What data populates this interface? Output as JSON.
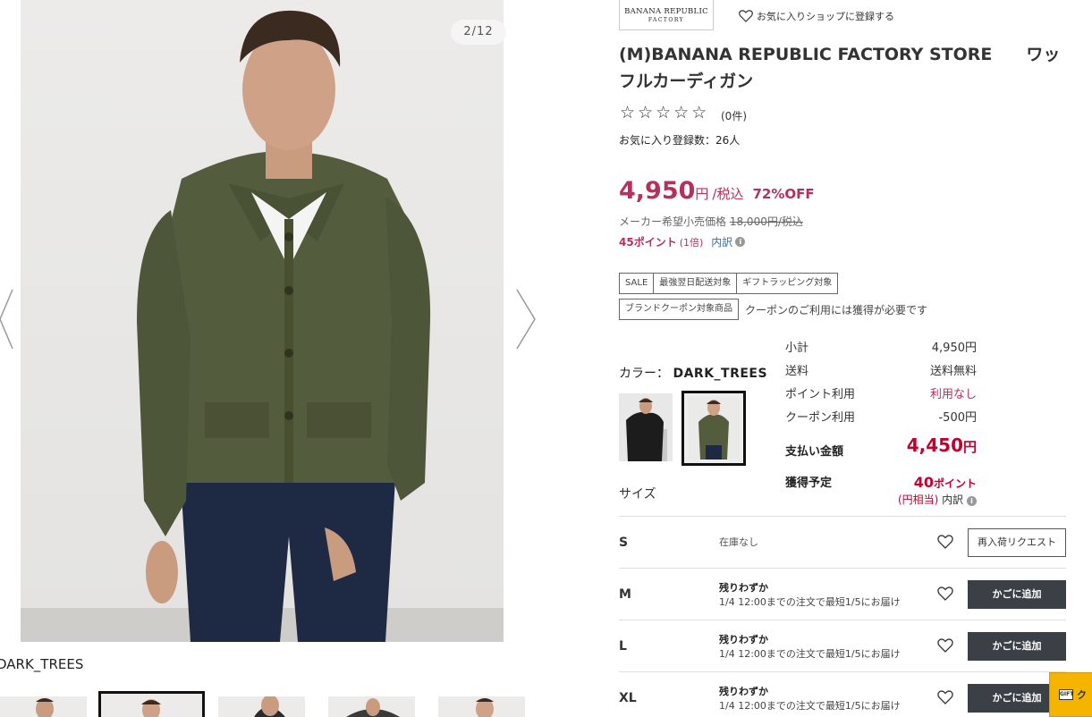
{
  "gallery": {
    "counter": "2/12",
    "color_name": "DARK_TREES"
  },
  "shop": {
    "logo_line1": "BANANA REPUBLIC",
    "logo_line2": "FACTORY",
    "fav_shop_label": "お気に入りショップに登録する"
  },
  "product": {
    "title": "(M)BANANA REPUBLIC FACTORY STORE　　ワッフルカーディガン",
    "stars": "☆☆☆☆☆",
    "review_count": "(0件)",
    "fav_count": "お気に入り登録数：26人"
  },
  "price": {
    "amount": "4,950",
    "yen": "円",
    "tax": "/税込",
    "discount": "72%OFF",
    "msrp_label": "メーカー希望小売価格",
    "msrp_value": "18,000円/税込",
    "points": "45ポイント",
    "points_mult": "(1倍)",
    "breakdown_link": "内訳"
  },
  "tags": [
    "SALE",
    "最強翌日配送対象",
    "ギフトラッピング対象"
  ],
  "coupon": {
    "tag": "ブランドクーポン対象商品",
    "note": "クーポンのご利用には獲得が必要です"
  },
  "color": {
    "label": "カラー：",
    "value": "DARK_TREES",
    "swatches": [
      "black",
      "dark-trees"
    ]
  },
  "size_label": "サイズ",
  "summary": {
    "subtotal_label": "小計",
    "subtotal_value": "4,950円",
    "shipping_label": "送料",
    "shipping_value": "送料無料",
    "points_use_label": "ポイント利用",
    "points_use_value": "利用なし",
    "coupon_use_label": "クーポン利用",
    "coupon_use_value": "-500円",
    "pay_label": "支払い金額",
    "pay_amount": "4,450",
    "pay_yen": "円",
    "earn_label": "獲得予定",
    "earn_amount": "40",
    "earn_unit": "ポイント",
    "earn_equiv": "(円相当)",
    "earn_breakdown": "内訳"
  },
  "sizes": [
    {
      "size": "S",
      "stock": "在庫なし",
      "ship": "",
      "button": "再入荷リクエスト",
      "button_style": "light"
    },
    {
      "size": "M",
      "stock": "残りわずか",
      "ship": "1/4 12:00までの注文で最短1/5にお届け",
      "button": "かごに追加",
      "button_style": "dark"
    },
    {
      "size": "L",
      "stock": "残りわずか",
      "ship": "1/4 12:00までの注文で最短1/5にお届け",
      "button": "かごに追加",
      "button_style": "dark"
    },
    {
      "size": "XL",
      "stock": "残りわずか",
      "ship": "1/4 12:00までの注文で最短1/5にお届け",
      "button": "かごに追加",
      "button_style": "dark"
    }
  ],
  "float_badge": {
    "icon": "gift-icon",
    "text": "ク"
  },
  "colors": {
    "price_red": "#b5315b",
    "pay_red": "#c2002f",
    "button_dark": "#3b3f46",
    "badge_yellow": "#f5b400"
  }
}
